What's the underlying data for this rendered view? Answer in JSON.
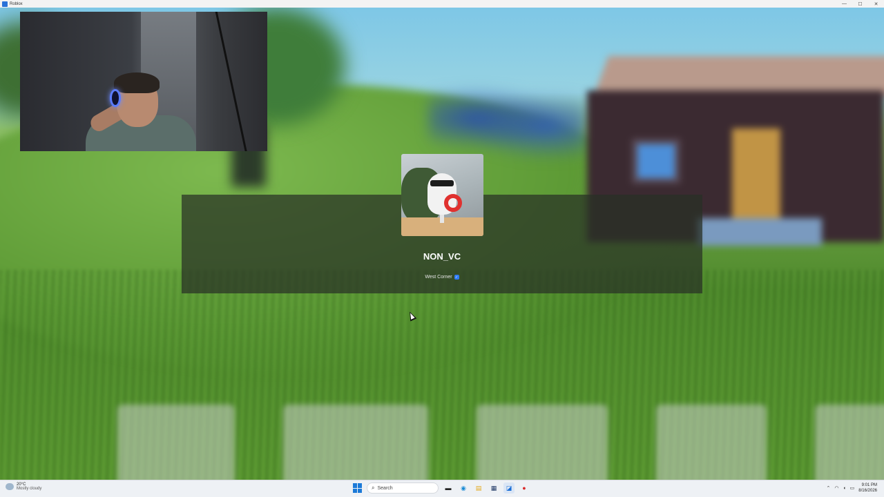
{
  "window": {
    "title": "Roblox",
    "controls": {
      "minimize": "—",
      "maximize": "☐",
      "close": "✕"
    }
  },
  "game": {
    "title": "NON_VC",
    "creator": "West Corner",
    "verified_mark": "✓"
  },
  "taskbar": {
    "weather": {
      "temp": "20°C",
      "condition": "Mostly cloudy"
    },
    "search_placeholder": "Search",
    "search_icon": "⌕",
    "apps": [
      {
        "name": "file-explorer",
        "glyph": "▬"
      },
      {
        "name": "edge",
        "glyph": "◉"
      },
      {
        "name": "folder",
        "glyph": "▤"
      },
      {
        "name": "store",
        "glyph": "▦"
      },
      {
        "name": "roblox-studio",
        "glyph": "◪"
      },
      {
        "name": "app-red",
        "glyph": "●"
      }
    ],
    "tray": {
      "chevron": "⌃",
      "wifi": "◠",
      "speaker": "◖",
      "battery": "▭"
    },
    "clock": {
      "time": "9:01 PM",
      "date": "8/16/2026"
    }
  },
  "colors": {
    "accent": "#1c7ad8",
    "verified": "#2f7cf6"
  }
}
